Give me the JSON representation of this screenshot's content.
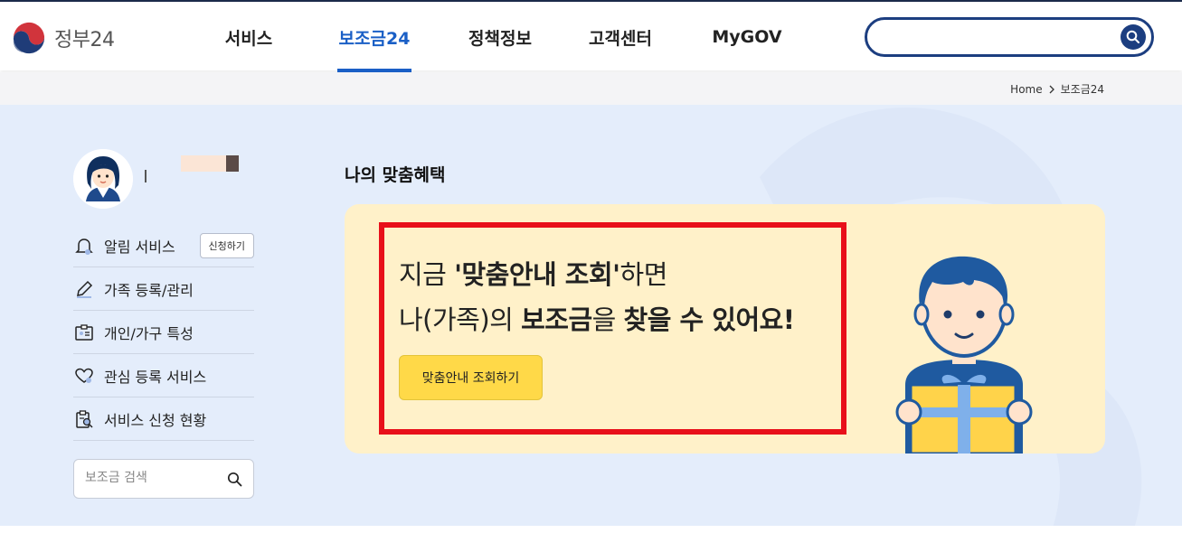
{
  "header": {
    "logo_text": "정부24",
    "nav": [
      {
        "label": "서비스",
        "active": false
      },
      {
        "label": "보조금24",
        "active": true
      },
      {
        "label": "정책정보",
        "active": false
      },
      {
        "label": "고객센터",
        "active": false
      },
      {
        "label": "MyGOV",
        "active": false
      }
    ],
    "search_value": "",
    "search_icon": "search-icon"
  },
  "breadcrumb": {
    "home": "Home",
    "current": "보조금24"
  },
  "sidebar": {
    "menu": [
      {
        "label": "알림 서비스",
        "icon": "bell-icon",
        "button": "신청하기"
      },
      {
        "label": "가족 등록/관리",
        "icon": "pencil-icon"
      },
      {
        "label": "개인/가구 특성",
        "icon": "id-card-icon"
      },
      {
        "label": "관심 등록 서비스",
        "icon": "heart-icon"
      },
      {
        "label": "서비스 신청 현황",
        "icon": "clipboard-search-icon"
      }
    ],
    "search_placeholder": "보조금 검색"
  },
  "main": {
    "section_title": "나의 맞춤혜택",
    "headline_line1_pre": "지금 ",
    "headline_line1_bold": "'맞춤안내 조회'",
    "headline_line1_post": "하면",
    "headline_line2_pre": "나(가족)의 ",
    "headline_line2_bold1": "보조금",
    "headline_line2_mid": "을 ",
    "headline_line2_bold2": "찾을 수 있어요!",
    "cta_label": "맞춤안내 조회하기"
  },
  "colors": {
    "accent": "#1a5fc6",
    "navy": "#1c3e80",
    "card_bg": "#fff1c9",
    "cta_bg": "#ffd948",
    "highlight_border": "#e8101a",
    "main_bg": "#e4edfb"
  }
}
